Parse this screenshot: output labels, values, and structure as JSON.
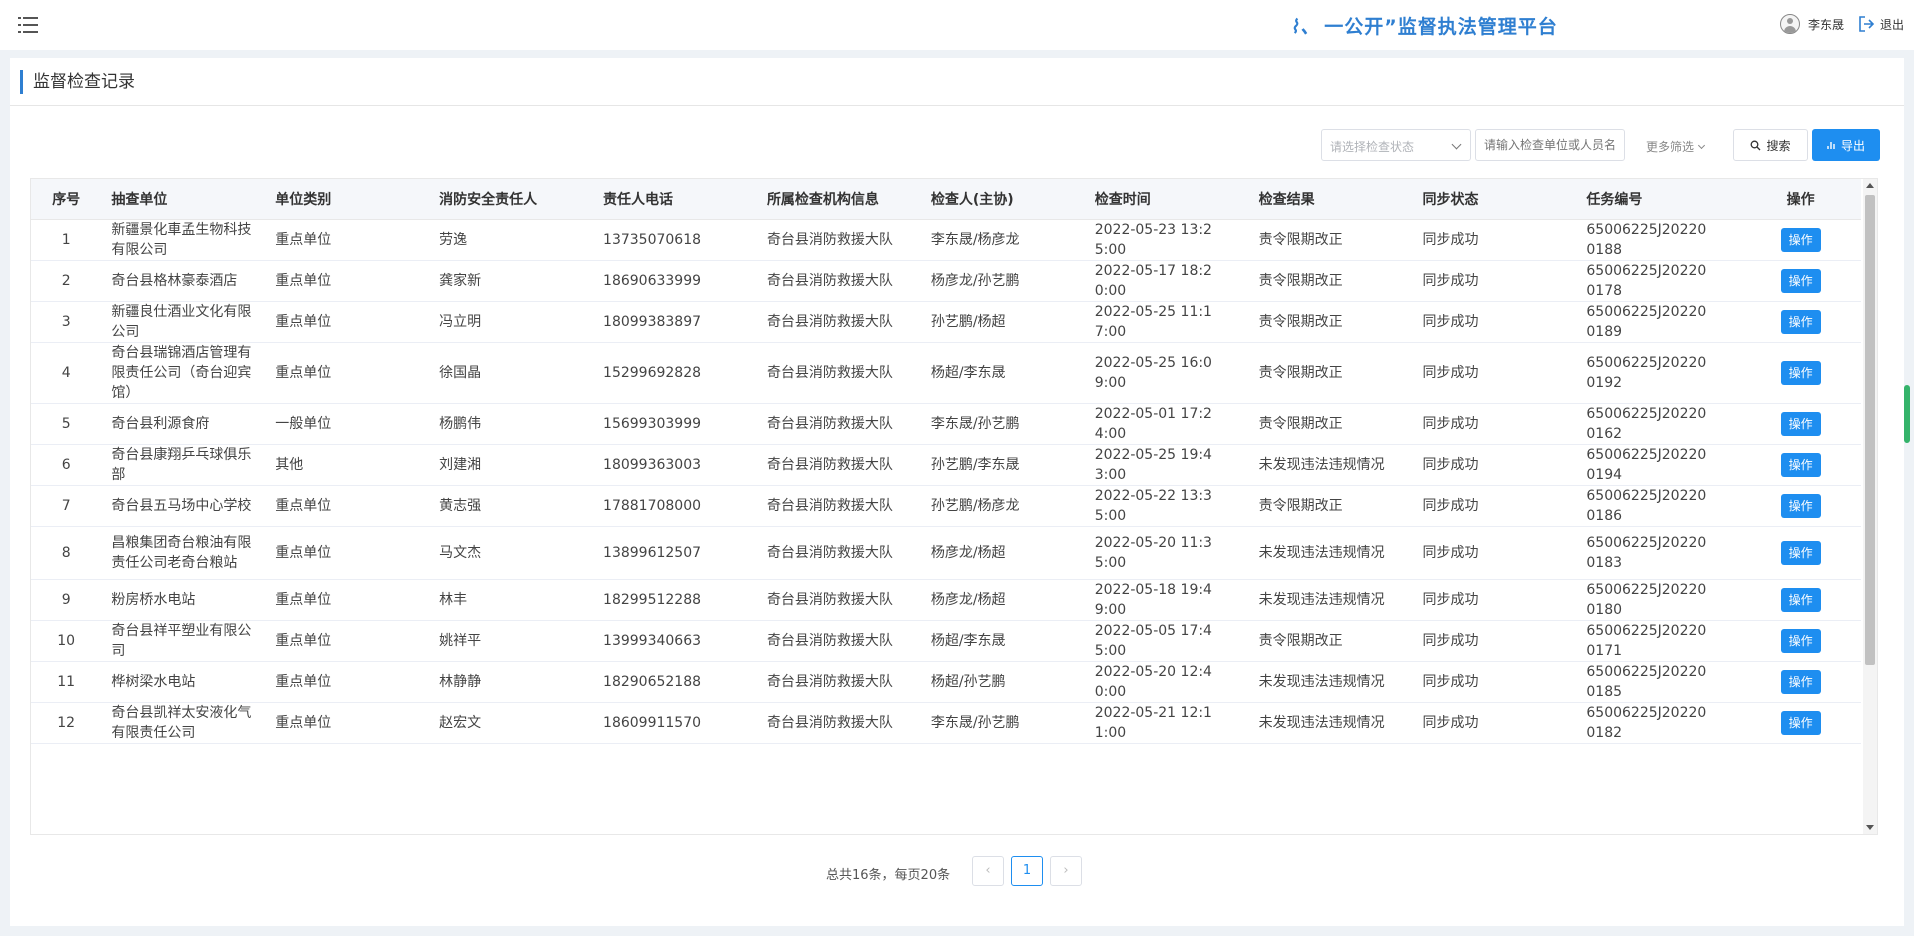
{
  "header": {
    "brand_mark": "⌇、",
    "brand_title": "一公开”监督执法管理平台",
    "username": "李东晟",
    "logout_label": "退出"
  },
  "page": {
    "title": "监督检查记录"
  },
  "filters": {
    "status_placeholder": "请选择检查状态",
    "search_placeholder": "请输入检查单位或人员名",
    "more_label": "更多筛选",
    "search_button": "搜索",
    "export_button": "导出"
  },
  "table": {
    "columns": [
      "序号",
      "抽查单位",
      "单位类别",
      "消防安全责任人",
      "责任人电话",
      "所属检查机构信息",
      "检查人(主协)",
      "检查时间",
      "检查结果",
      "同步状态",
      "任务编号",
      "操作"
    ],
    "op_label": "操作",
    "rows": [
      {
        "idx": "1",
        "unit": "新疆景化車孟生物科技有限公司",
        "category": "重点单位",
        "person": "劳逸",
        "phone": "13735070618",
        "org": "奇台县消防救援大队",
        "inspector": "李东晟/杨彦龙",
        "time": "2022-05-23 13:25:00",
        "result": "责令限期改正",
        "sync": "同步成功",
        "task": "65006225J202200188"
      },
      {
        "idx": "2",
        "unit": "奇台县格林豪泰酒店",
        "category": "重点单位",
        "person": "龚家新",
        "phone": "18690633999",
        "org": "奇台县消防救援大队",
        "inspector": "杨彦龙/孙艺鹏",
        "time": "2022-05-17 18:20:00",
        "result": "责令限期改正",
        "sync": "同步成功",
        "task": "65006225J202200178"
      },
      {
        "idx": "3",
        "unit": "新疆良仕酒业文化有限公司",
        "category": "重点单位",
        "person": "冯立明",
        "phone": "18099383897",
        "org": "奇台县消防救援大队",
        "inspector": "孙艺鹏/杨超",
        "time": "2022-05-25 11:17:00",
        "result": "责令限期改正",
        "sync": "同步成功",
        "task": "65006225J202200189"
      },
      {
        "idx": "4",
        "unit": "奇台县瑞锦酒店管理有限责任公司（奇台迎宾馆）",
        "category": "重点单位",
        "person": "徐国晶",
        "phone": "15299692828",
        "org": "奇台县消防救援大队",
        "inspector": "杨超/李东晟",
        "time": "2022-05-25 16:09:00",
        "result": "责令限期改正",
        "sync": "同步成功",
        "task": "65006225J202200192"
      },
      {
        "idx": "5",
        "unit": "奇台县利源食府",
        "category": "一般单位",
        "person": "杨鹏伟",
        "phone": "15699303999",
        "org": "奇台县消防救援大队",
        "inspector": "李东晟/孙艺鹏",
        "time": "2022-05-01 17:24:00",
        "result": "责令限期改正",
        "sync": "同步成功",
        "task": "65006225J202200162"
      },
      {
        "idx": "6",
        "unit": "奇台县康翔乒乓球俱乐部",
        "category": "其他",
        "person": "刘建湘",
        "phone": "18099363003",
        "org": "奇台县消防救援大队",
        "inspector": "孙艺鹏/李东晟",
        "time": "2022-05-25 19:43:00",
        "result": "未发现违法违规情况",
        "sync": "同步成功",
        "task": "65006225J202200194"
      },
      {
        "idx": "7",
        "unit": "奇台县五马场中心学校",
        "category": "重点单位",
        "person": "黄志强",
        "phone": "17881708000",
        "org": "奇台县消防救援大队",
        "inspector": "孙艺鹏/杨彦龙",
        "time": "2022-05-22 13:35:00",
        "result": "责令限期改正",
        "sync": "同步成功",
        "task": "65006225J202200186"
      },
      {
        "idx": "8",
        "unit": "昌粮集团奇台粮油有限责任公司老奇台粮站",
        "category": "重点单位",
        "person": "马文杰",
        "phone": "13899612507",
        "org": "奇台县消防救援大队",
        "inspector": "杨彦龙/杨超",
        "time": "2022-05-20 11:35:00",
        "result": "未发现违法违规情况",
        "sync": "同步成功",
        "task": "65006225J202200183"
      },
      {
        "idx": "9",
        "unit": "粉房桥水电站",
        "category": "重点单位",
        "person": "林丰",
        "phone": "18299512288",
        "org": "奇台县消防救援大队",
        "inspector": "杨彦龙/杨超",
        "time": "2022-05-18 19:49:00",
        "result": "未发现违法违规情况",
        "sync": "同步成功",
        "task": "65006225J202200180"
      },
      {
        "idx": "10",
        "unit": "奇台县祥平塑业有限公司",
        "category": "重点单位",
        "person": "姚祥平",
        "phone": "13999340663",
        "org": "奇台县消防救援大队",
        "inspector": "杨超/李东晟",
        "time": "2022-05-05 17:45:00",
        "result": "责令限期改正",
        "sync": "同步成功",
        "task": "65006225J202200171"
      },
      {
        "idx": "11",
        "unit": "桦树梁水电站",
        "category": "重点单位",
        "person": "林静静",
        "phone": "18290652188",
        "org": "奇台县消防救援大队",
        "inspector": "杨超/孙艺鹏",
        "time": "2022-05-20 12:40:00",
        "result": "未发现违法违规情况",
        "sync": "同步成功",
        "task": "65006225J202200185"
      },
      {
        "idx": "12",
        "unit": "奇台县凯祥太安液化气有限责任公司",
        "category": "重点单位",
        "person": "赵宏文",
        "phone": "18609911570",
        "org": "奇台县消防救援大队",
        "inspector": "李东晟/孙艺鹏",
        "time": "2022-05-21 12:11:00",
        "result": "未发现违法违规情况",
        "sync": "同步成功",
        "task": "65006225J202200182"
      }
    ]
  },
  "pagination": {
    "summary": "总共16条，每页20条",
    "current_page": "1",
    "prev_symbol": "‹",
    "next_symbol": "›"
  }
}
